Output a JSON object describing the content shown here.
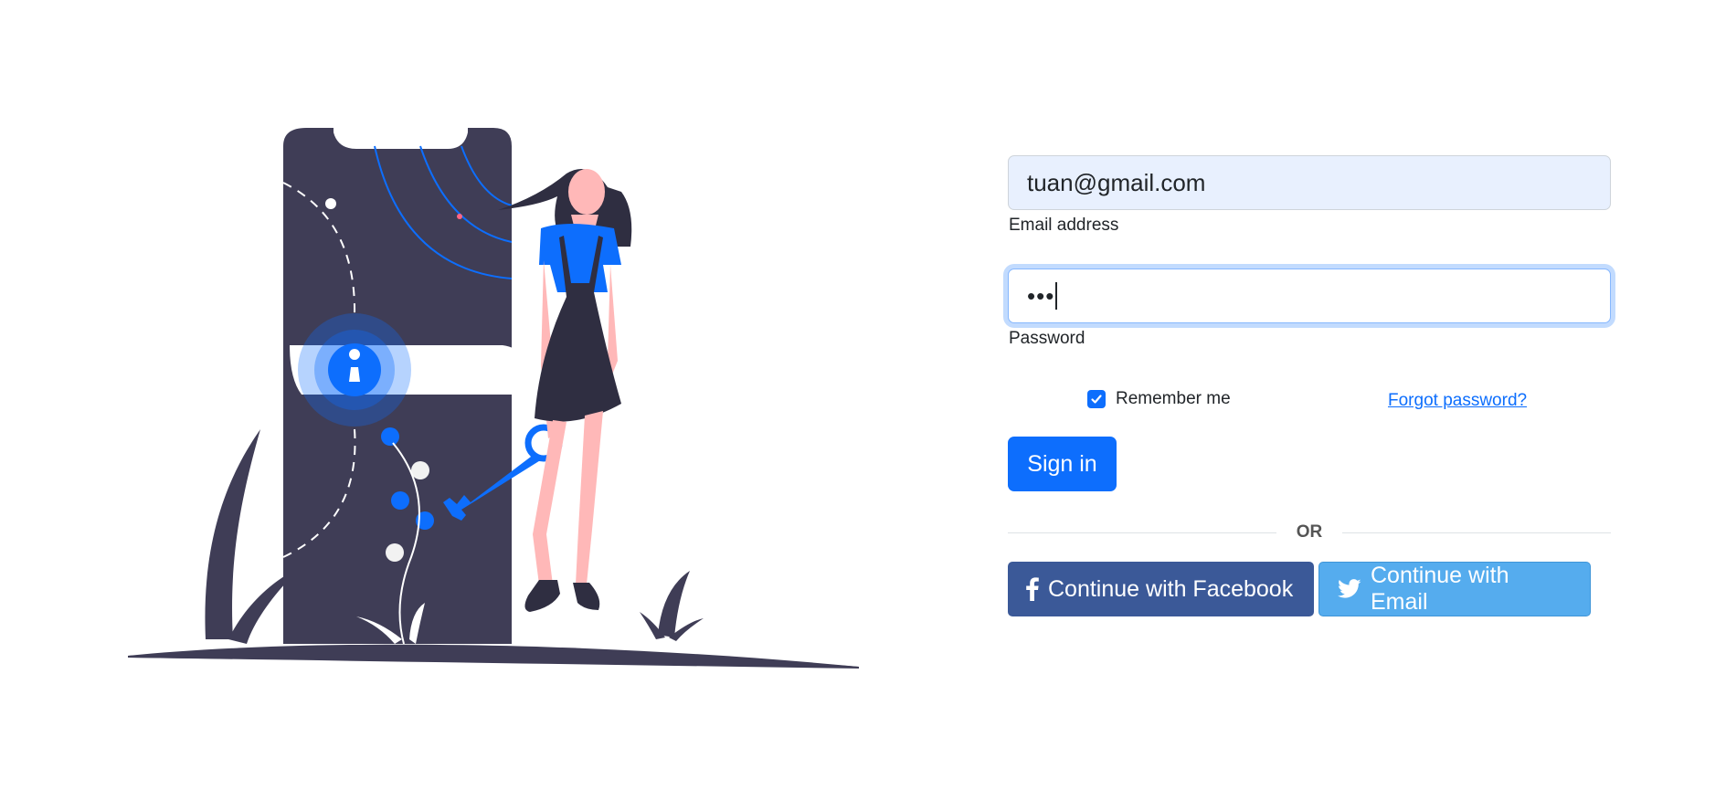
{
  "login": {
    "email": {
      "value": "tuan@gmail.com",
      "label": "Email address"
    },
    "password": {
      "value": "•••",
      "label": "Password"
    },
    "remember": {
      "label": "Remember me",
      "checked": true
    },
    "forgot_label": "Forgot password?",
    "signin_label": "Sign in",
    "divider_label": "OR",
    "facebook_label": "Continue with Facebook",
    "twitter_label": "Continue with Email"
  },
  "icons": {
    "illustration": "woman-with-key-and-phone-lock-illustration",
    "facebook": "facebook-icon",
    "twitter": "twitter-icon",
    "checkbox": "check-icon"
  },
  "colors": {
    "primary": "#0d6efd",
    "facebook": "#3b5998",
    "twitter": "#55acee",
    "illustration_dark": "#3f3d56",
    "field_fill": "#e8f0fe"
  }
}
